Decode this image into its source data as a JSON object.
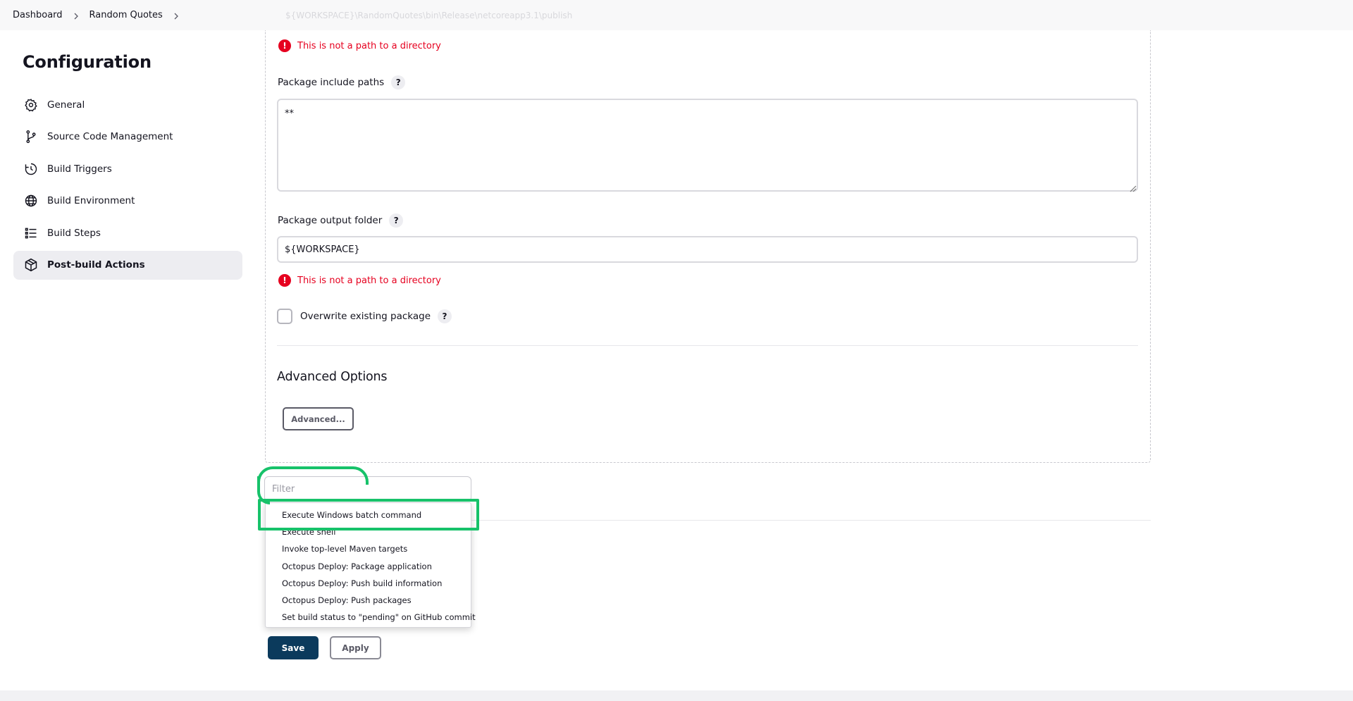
{
  "breadcrumb": {
    "items": [
      "Dashboard",
      "Random Quotes"
    ],
    "faded_path": "${WORKSPACE}\\RandomQuotes\\bin\\Release\\netcoreapp3.1\\publish"
  },
  "sidebar": {
    "title": "Configuration",
    "items": [
      {
        "label": "General",
        "icon": "gear-icon"
      },
      {
        "label": "Source Code Management",
        "icon": "git-branch-icon"
      },
      {
        "label": "Build Triggers",
        "icon": "clock-icon"
      },
      {
        "label": "Build Environment",
        "icon": "globe-icon"
      },
      {
        "label": "Build Steps",
        "icon": "list-icon"
      },
      {
        "label": "Post-build Actions",
        "icon": "package-icon",
        "active": true
      }
    ]
  },
  "form": {
    "error_1": "This is not a path to a directory",
    "include_label": "Package include paths",
    "include_value": "**",
    "output_label": "Package output folder",
    "output_value": "${WORKSPACE}",
    "error_2": "This is not a path to a directory",
    "overwrite_label": "Overwrite existing package",
    "help_glyph": "?",
    "advanced_heading": "Advanced Options",
    "advanced_button": "Advanced..."
  },
  "dropdown": {
    "filter_placeholder": "Filter",
    "items": [
      "Execute Windows batch command",
      "Execute shell",
      "Invoke top-level Maven targets",
      "Octopus Deploy: Package application",
      "Octopus Deploy: Push build information",
      "Octopus Deploy: Push packages",
      "Set build status to \"pending\" on GitHub commit"
    ]
  },
  "actions": {
    "save": "Save",
    "apply": "Apply"
  },
  "colors": {
    "error": "#e6001f",
    "save_bg": "#0b3a5c",
    "highlight": "#17c26a"
  }
}
